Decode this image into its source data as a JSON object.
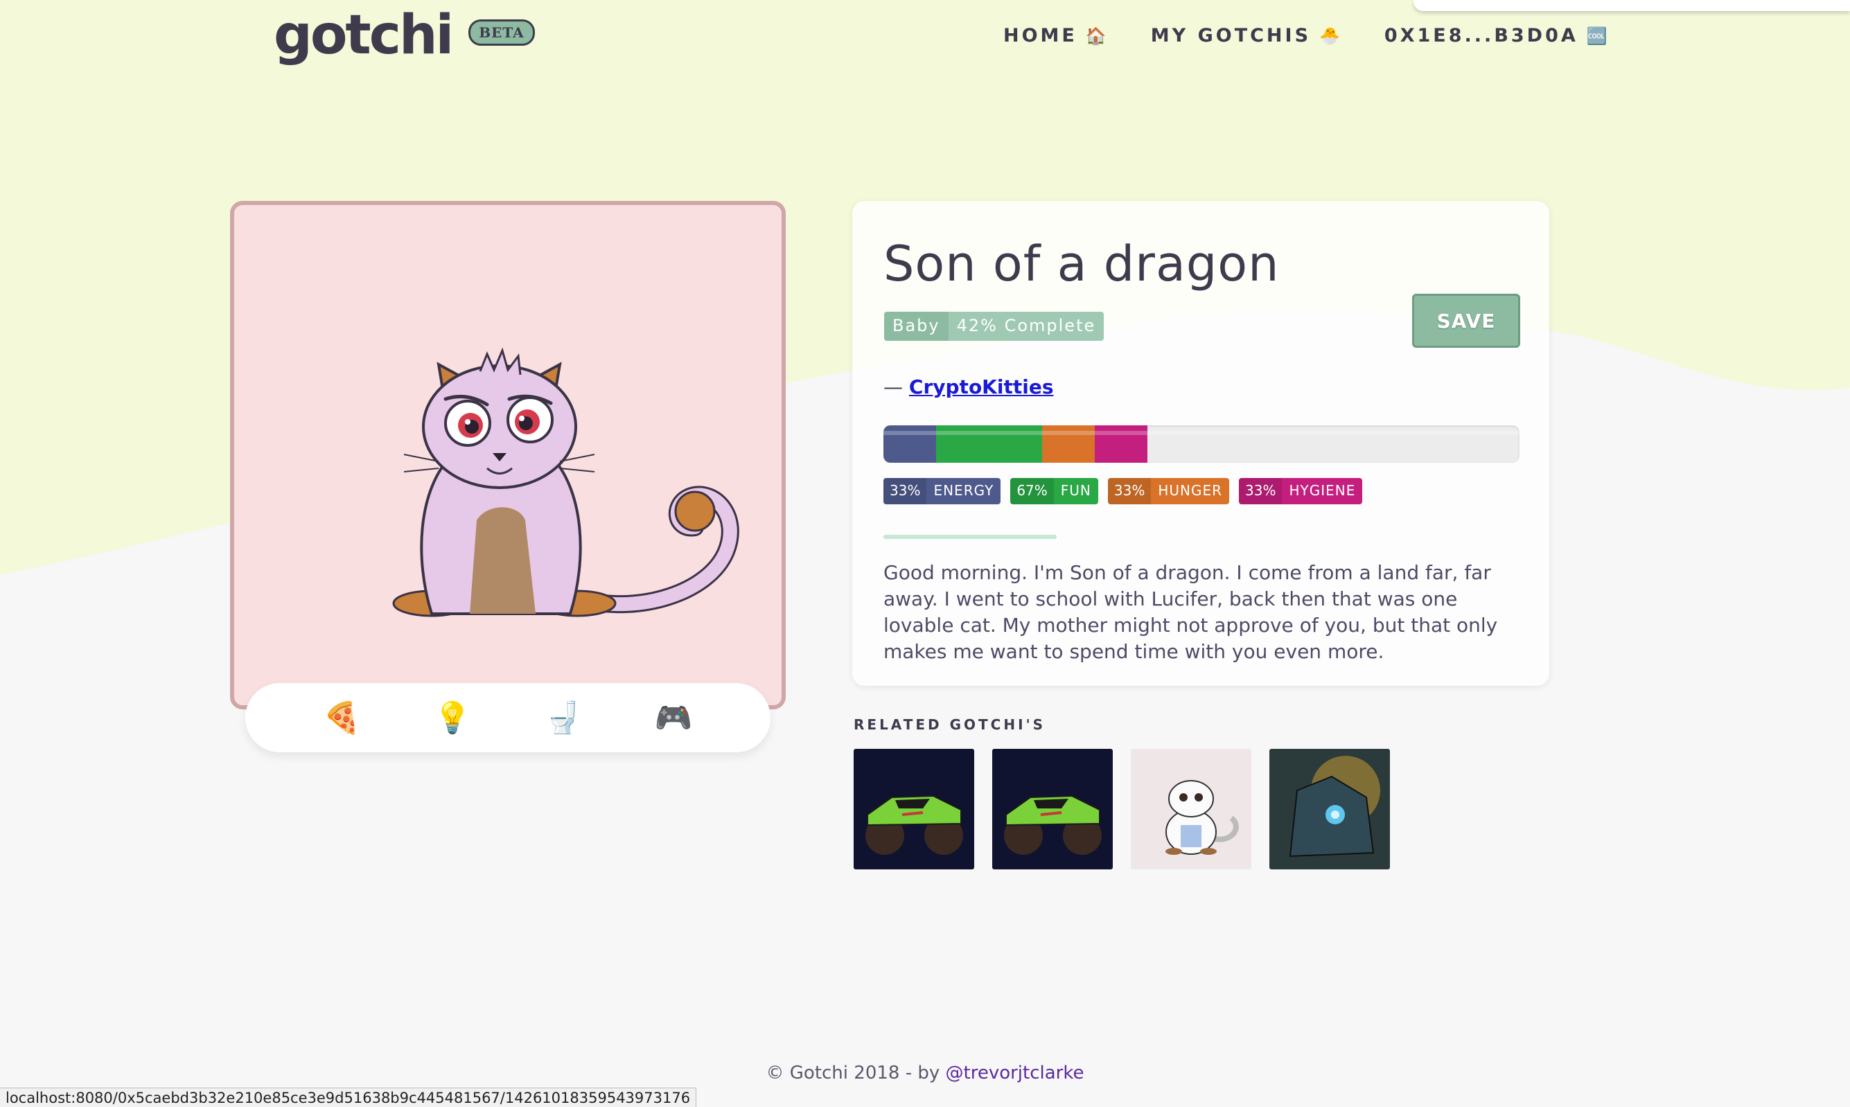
{
  "header": {
    "logo_text": "gotchi",
    "beta_label": "BETA",
    "nav": [
      {
        "label": "HOME",
        "emoji": "🏠"
      },
      {
        "label": "MY GOTCHIS",
        "emoji": "🐣"
      },
      {
        "label": "0X1E8...B3D0A",
        "emoji": "🆒"
      }
    ]
  },
  "gotchi": {
    "name": "Son of a dragon",
    "stage": "Baby",
    "completion": "42% Complete",
    "save_label": "SAVE",
    "source_prefix": "—",
    "source_link": "CryptoKitties",
    "stats": [
      {
        "pct_label": "33%",
        "label": "ENERGY",
        "value": 33,
        "color": "#4e5a8c"
      },
      {
        "pct_label": "67%",
        "label": "FUN",
        "value": 67,
        "color": "#2aa846"
      },
      {
        "pct_label": "33%",
        "label": "HUNGER",
        "value": 33,
        "color": "#d9732a"
      },
      {
        "pct_label": "33%",
        "label": "HYGIENE",
        "value": 33,
        "color": "#c41f7e"
      }
    ],
    "bio": "Good morning. I'm Son of a dragon. I come from a land far, far away. I went to school with Lucifer, back then that was one lovable cat. My mother might not approve of you, but that only makes me want to spend time with you even more."
  },
  "actions": [
    {
      "name": "feed-button",
      "emoji": "🍕"
    },
    {
      "name": "energy-button",
      "emoji": "💡"
    },
    {
      "name": "clean-button",
      "emoji": "🚽"
    },
    {
      "name": "play-button",
      "emoji": "🎮"
    }
  ],
  "related": {
    "title": "RELATED GOTCHI'S"
  },
  "footer": {
    "text": "© Gotchi 2018 - by",
    "author": "@trevorjtclarke"
  },
  "status_url": "localhost:8080/0x5caebd3b32e210e85ce3e9d51638b9c445481567/142610183595439731​76",
  "colors": {
    "background_top": "#f3f9d9",
    "accent": "#8cbba2",
    "text": "#403a4d"
  }
}
